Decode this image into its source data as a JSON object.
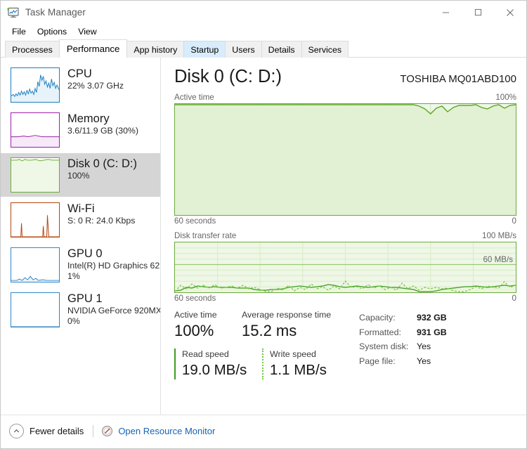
{
  "window": {
    "title": "Task Manager",
    "icon": "task-manager-icon",
    "minimize": "minimize-icon",
    "maximize": "maximize-icon",
    "close": "close-icon"
  },
  "menu": {
    "items": [
      {
        "label": "File"
      },
      {
        "label": "Options"
      },
      {
        "label": "View"
      }
    ]
  },
  "tabs": [
    {
      "label": "Processes",
      "state": "normal"
    },
    {
      "label": "Performance",
      "state": "active"
    },
    {
      "label": "App history",
      "state": "normal"
    },
    {
      "label": "Startup",
      "state": "hot"
    },
    {
      "label": "Users",
      "state": "normal"
    },
    {
      "label": "Details",
      "state": "normal"
    },
    {
      "label": "Services",
      "state": "normal"
    }
  ],
  "sidebar": {
    "items": [
      {
        "name": "CPU",
        "sub1": "22%  3.07 GHz",
        "sub2": "",
        "color": "#1a7fc1",
        "fill": "#e8f2fa",
        "selected": false
      },
      {
        "name": "Memory",
        "sub1": "3.6/11.9 GB (30%)",
        "sub2": "",
        "color": "#9b21a8",
        "fill": "#f6eaf8",
        "selected": false
      },
      {
        "name": "Disk 0 (C: D:)",
        "sub1": "100%",
        "sub2": "",
        "color": "#6aab3c",
        "fill": "#eff7e7",
        "selected": true
      },
      {
        "name": "Wi-Fi",
        "sub1": "S: 0  R: 24.0 Kbps",
        "sub2": "",
        "color": "#b5450f",
        "fill": "#fbf0e8",
        "selected": false
      },
      {
        "name": "GPU 0",
        "sub1": "Intel(R) HD Graphics 62",
        "sub2": "1%",
        "color": "#2e86c8",
        "fill": "#eaf3fb",
        "selected": false
      },
      {
        "name": "GPU 1",
        "sub1": "NVIDIA GeForce 920MX",
        "sub2": "0%",
        "color": "#2e86c8",
        "fill": "#eaf3fb",
        "selected": false
      }
    ]
  },
  "main": {
    "title": "Disk 0 (C: D:)",
    "model": "TOSHIBA MQ01ABD100",
    "graph_active": {
      "caption": "Active time",
      "max_label": "100%",
      "left_foot": "60 seconds",
      "right_foot": "0"
    },
    "graph_transfer": {
      "caption": "Disk transfer rate",
      "max_label": "100 MB/s",
      "inline_label": "60 MB/s",
      "left_foot": "60 seconds",
      "right_foot": "0"
    },
    "stats": {
      "active_time_label": "Active time",
      "active_time_value": "100%",
      "response_label": "Average response time",
      "response_value": "15.2 ms",
      "read_label": "Read speed",
      "read_value": "19.0 MB/s",
      "write_label": "Write speed",
      "write_value": "1.1 MB/s"
    },
    "info": [
      {
        "key": "Capacity:",
        "value": "932 GB"
      },
      {
        "key": "Formatted:",
        "value": "931 GB"
      },
      {
        "key": "System disk:",
        "value": "Yes"
      },
      {
        "key": "Page file:",
        "value": "Yes"
      }
    ]
  },
  "statusbar": {
    "fewer_details": "Fewer details",
    "chevron_icon": "chevron-up-circle-icon",
    "resource_monitor_icon": "resource-monitor-icon",
    "resource_monitor": "Open Resource Monitor"
  },
  "colors": {
    "disk_accent": "#6aab3c",
    "disk_fill": "#eff7e7",
    "link": "#1763b4",
    "selection": "#d5d5d5",
    "read_line": "#3e9a1f",
    "write_line": "#7ace3e"
  },
  "chart_data": [
    {
      "type": "area",
      "title": "Active time",
      "ylabel": "%",
      "xlabel": "60 seconds",
      "ylim": [
        0,
        100
      ],
      "xlim": [
        0,
        60
      ],
      "values": [
        100,
        100,
        100,
        100,
        100,
        100,
        100,
        100,
        100,
        100,
        100,
        100,
        100,
        100,
        100,
        100,
        100,
        100,
        100,
        100,
        100,
        100,
        100,
        100,
        100,
        100,
        100,
        100,
        100,
        100,
        100,
        100,
        100,
        100,
        100,
        100,
        100,
        100,
        100,
        100,
        100,
        100,
        100,
        100,
        100,
        100,
        97,
        95,
        92,
        96,
        91,
        96,
        100,
        100,
        98,
        96,
        100,
        97,
        96,
        100,
        100
      ],
      "grid": true
    },
    {
      "type": "line",
      "title": "Disk transfer rate",
      "ylabel": "MB/s",
      "xlabel": "60 seconds",
      "ylim": [
        0,
        100
      ],
      "xlim": [
        0,
        60
      ],
      "annotations": [
        "60 MB/s"
      ],
      "series": [
        {
          "name": "Read speed",
          "values": [
            2,
            4,
            9,
            8,
            12,
            11,
            10,
            9,
            11,
            10,
            10,
            10,
            9,
            9,
            9,
            9,
            6,
            5,
            4,
            4,
            5,
            5,
            7,
            9,
            10,
            11,
            9,
            8,
            9,
            11,
            14,
            12,
            10,
            9,
            8,
            9,
            11,
            13,
            11,
            9,
            10,
            11,
            12,
            10,
            9,
            9,
            8,
            7,
            6,
            2,
            1,
            1,
            2,
            4,
            6,
            7,
            8,
            9,
            10,
            10,
            11
          ]
        },
        {
          "name": "Write speed",
          "values": [
            1,
            12,
            6,
            14,
            7,
            12,
            8,
            13,
            7,
            9,
            11,
            8,
            12,
            7,
            9,
            6,
            2,
            1,
            7,
            4,
            12,
            3,
            9,
            5,
            14,
            6,
            10,
            4,
            11,
            7,
            18,
            8,
            10,
            6,
            13,
            7,
            11,
            5,
            9,
            4,
            16,
            6,
            12,
            5,
            10,
            7,
            9,
            6,
            8,
            3,
            1,
            1,
            5,
            9,
            6,
            11,
            8,
            7,
            19,
            8,
            12
          ]
        }
      ],
      "grid": true
    }
  ]
}
